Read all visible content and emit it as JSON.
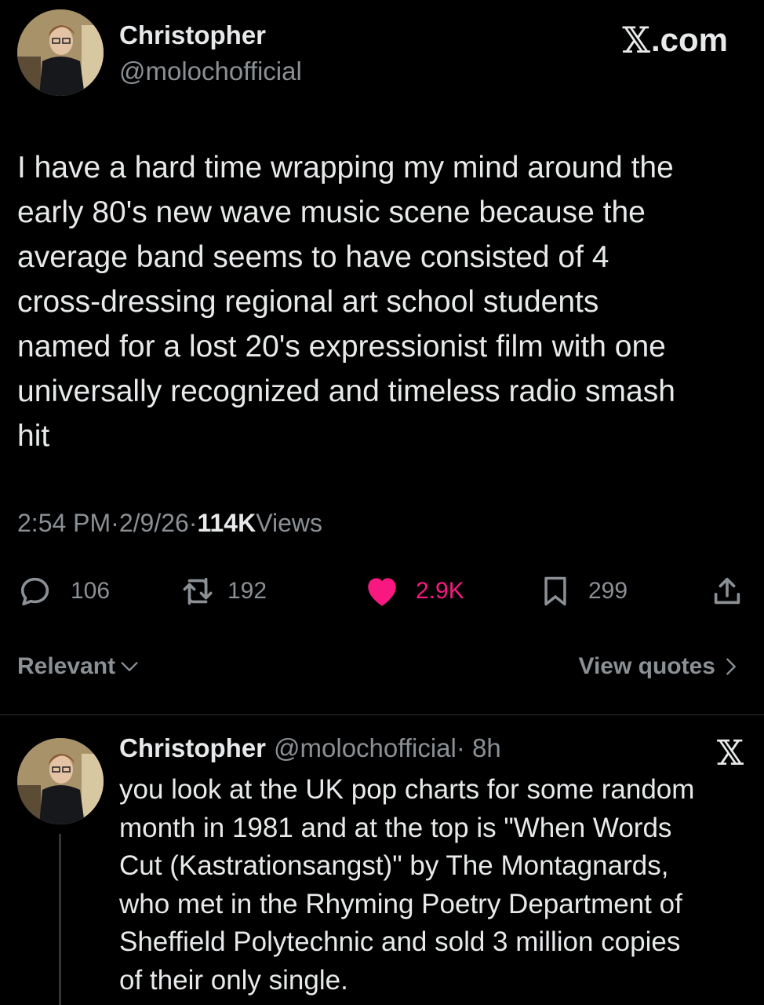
{
  "main_tweet": {
    "author": {
      "display_name": "Christopher",
      "handle": "@molochofficial"
    },
    "brand": "X.com",
    "brand_letter": "𝕏",
    "brand_suffix": ".com",
    "text": "I have a hard time wrapping my mind around the\nearly 80's new wave music scene because the\naverage band seems to have consisted of 4\ncross-dressing regional art school students\nnamed for a lost 20's expressionist film with one\nuniversally recognized and timeless radio smash\nhit",
    "time": "2:54 PM",
    "sep": " · ",
    "date": "2/9/26",
    "views_count": "114K",
    "views_label": " Views",
    "actions": {
      "replies": "106",
      "reposts": "192",
      "likes": "2.9K",
      "bookmarks": "299"
    },
    "colors": {
      "like": "#f91880",
      "muted": "#8b9095",
      "text": "#e7e9ea"
    }
  },
  "sort": {
    "label": "Relevant",
    "view_quotes": "View quotes"
  },
  "reply": {
    "author": {
      "display_name": "Christopher",
      "handle": "@molochofficial",
      "time": " · 8h"
    },
    "brand_letter": "𝕏",
    "text": "you look at the UK pop charts for some random\nmonth in 1981 and at the top is \"When Words\nCut (Kastrationsangst)\" by The Montagnards,\nwho met in the Rhyming Poetry Department of\nSheffield Polytechnic and sold 3 million copies\nof their only single."
  },
  "icons": {
    "reply": "reply-bubble-icon",
    "repost": "repost-icon",
    "like": "heart-icon",
    "bookmark": "bookmark-icon",
    "share": "share-icon",
    "chevron_down": "chevron-down-icon",
    "chevron_right": "chevron-right-icon"
  }
}
